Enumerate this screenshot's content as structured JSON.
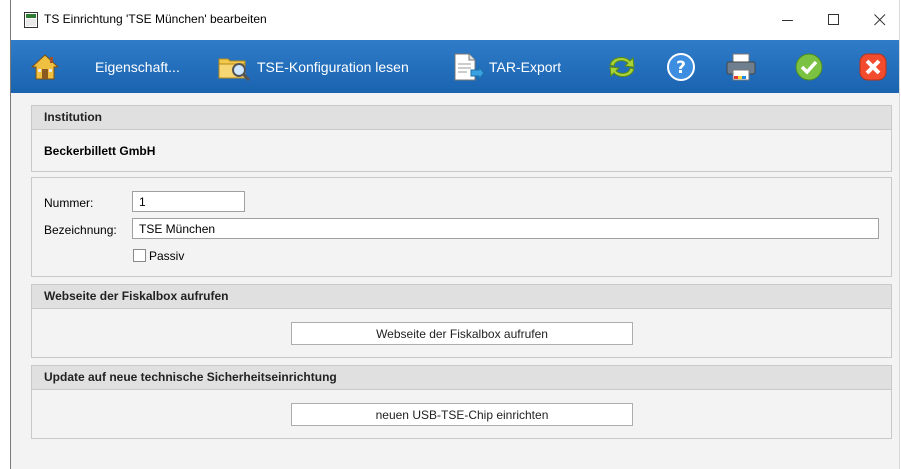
{
  "window": {
    "title": "TS Einrichtung 'TSE München' bearbeiten",
    "controls": {
      "minimize": "minimize-icon",
      "maximize": "maximize-icon",
      "close": "close-icon"
    }
  },
  "toolbar": {
    "background": "#1f6bb8",
    "items": [
      {
        "icon": "house-icon",
        "label": ""
      },
      {
        "icon": "",
        "label": "Eigenschaft..."
      },
      {
        "icon": "folder-search-icon",
        "label": "TSE-Konfiguration lesen"
      },
      {
        "icon": "document-export-icon",
        "label": "TAR-Export"
      },
      {
        "icon": "refresh-icon",
        "label": ""
      },
      {
        "icon": "help-icon",
        "label": ""
      },
      {
        "icon": "printer-icon",
        "label": ""
      },
      {
        "icon": "confirm-icon",
        "label": ""
      },
      {
        "icon": "cancel-icon",
        "label": ""
      }
    ]
  },
  "institution": {
    "header": "Institution",
    "name": "Beckerbillett GmbH"
  },
  "details": {
    "nummer_label": "Nummer:",
    "nummer_value": "1",
    "bezeichnung_label": "Bezeichnung:",
    "bezeichnung_value": "TSE München",
    "passiv_label": "Passiv",
    "passiv_checked": false
  },
  "website": {
    "header": "Webseite der Fiskalbox aufrufen",
    "button": "Webseite der Fiskalbox aufrufen"
  },
  "update": {
    "header": "Update auf neue technische Sicherheitseinrichtung",
    "button": "neuen USB-TSE-Chip einrichten"
  }
}
